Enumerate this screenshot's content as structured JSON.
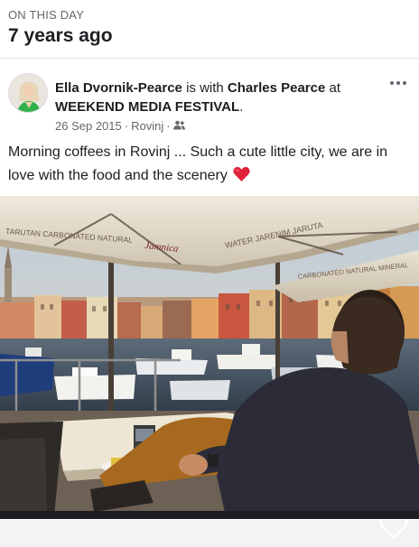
{
  "memory": {
    "eyebrow": "ON THIS DAY",
    "title": "7 years ago"
  },
  "post": {
    "author": "Ella Dvornik-Pearce",
    "with_word": " is with ",
    "tagged": "Charles Pearce",
    "at_word": " at ",
    "place": "WEEKEND MEDIA FESTIVAL",
    "period": ".",
    "date": "26 Sep 2015",
    "location": "Rovinj",
    "separator": "·",
    "audience_icon": "friends-icon",
    "text": "Morning coffees in Rovinj ... Such a cute little city, we are in love with the food and the scenery",
    "emoji": "red-heart-emoji",
    "more_icon": "more-options-icon",
    "like_icon": "heart-outline-icon",
    "photo": {
      "umbrella_text": "CARBONATED NATURAL MINERAL WATER",
      "umbrella_brand": "Jamnica",
      "description_color_sky": "#cfd9e2",
      "description_color_canopy": "#e8e1d3"
    }
  }
}
